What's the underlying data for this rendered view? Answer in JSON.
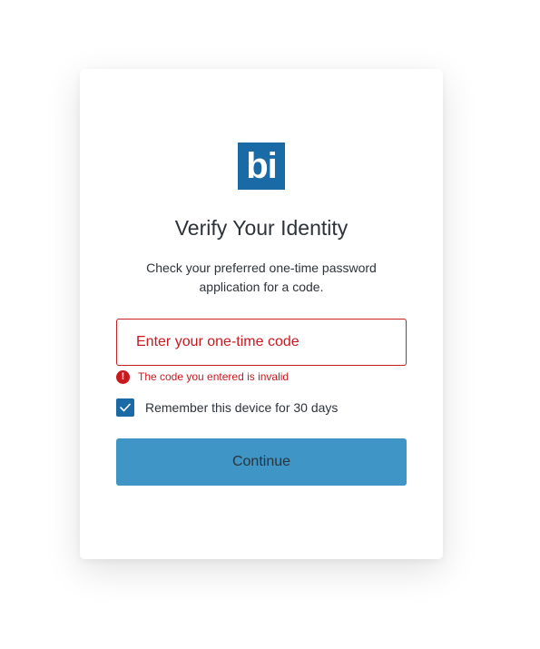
{
  "logo": {
    "text": "bi",
    "color": "#1a6aa6"
  },
  "title": "Verify Your Identity",
  "subtitle": "Check your preferred one-time password application for a code.",
  "code_input": {
    "placeholder": "Enter your one-time code",
    "value": "",
    "state": "error"
  },
  "error": {
    "icon": "exclamation-icon",
    "glyph": "!",
    "message": "The code you entered is invalid",
    "color": "#c8191f"
  },
  "remember": {
    "label": "Remember this device for 30 days",
    "checked": true
  },
  "continue_button": {
    "label": "Continue",
    "color": "#3e95c6"
  }
}
